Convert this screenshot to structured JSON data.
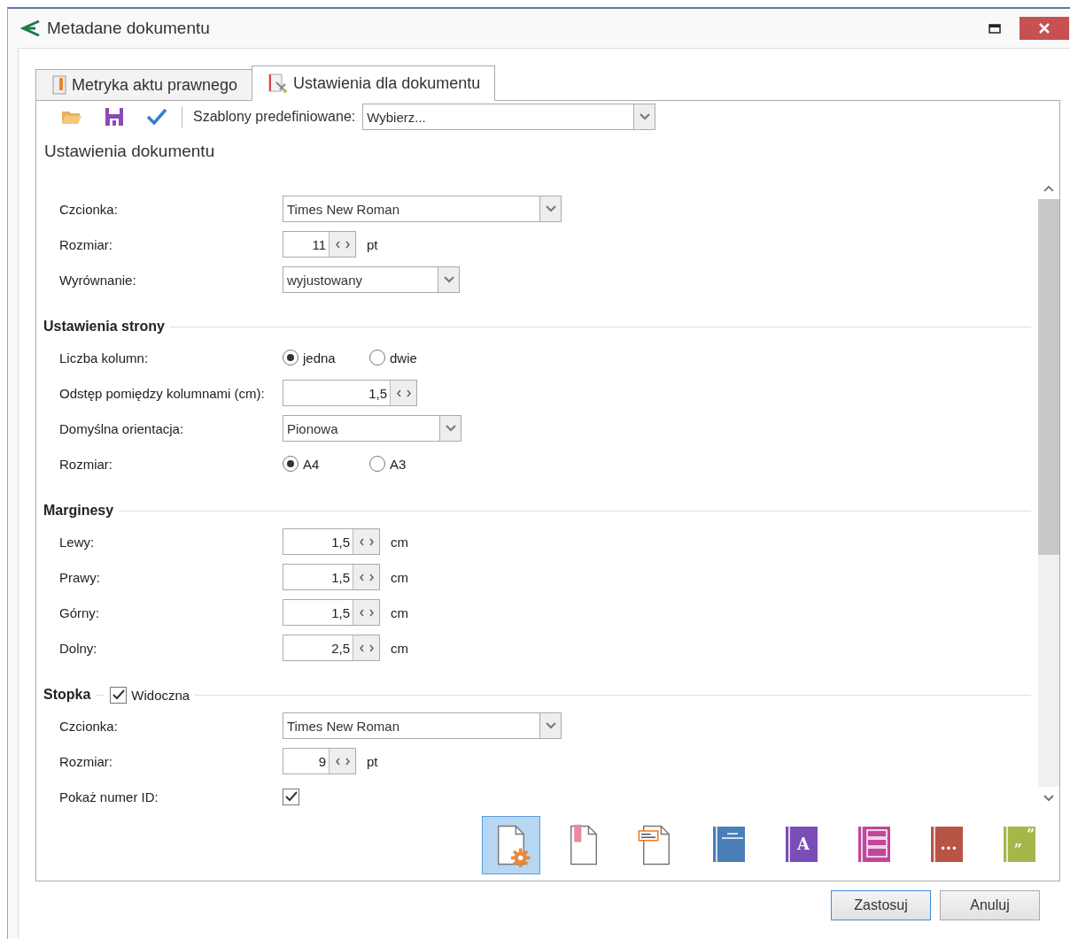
{
  "window": {
    "title": "Metadane dokumentu"
  },
  "tabs": [
    {
      "label": "Metryka aktu prawnego",
      "selected": false,
      "kind": "metric"
    },
    {
      "label": "Ustawienia dla dokumentu",
      "selected": true,
      "kind": "settings"
    }
  ],
  "toolbar": {
    "tools": [
      {
        "kind": "open"
      },
      {
        "kind": "save"
      },
      {
        "kind": "apply"
      }
    ],
    "template_label": "Szablony predefiniowane:",
    "template_value": "Wybierz..."
  },
  "heading": "Ustawienia dokumentu",
  "sections": [
    {
      "rows": [
        {
          "kind": "select",
          "label": "Czcionka:",
          "value": "Times New Roman"
        },
        {
          "kind": "spin",
          "label": "Rozmiar:",
          "value": "11",
          "unit": "pt"
        },
        {
          "kind": "select",
          "label": "Wyrównanie:",
          "value": "wyjustowany"
        }
      ]
    },
    {
      "title": "Ustawienia strony",
      "rows": [
        {
          "kind": "radio",
          "label": "Liczba kolumn:",
          "options": [
            {
              "label": "jedna",
              "selected": true
            },
            {
              "label": "dwie",
              "selected": false
            }
          ]
        },
        {
          "kind": "spin",
          "label": "Odstęp pomiędzy kolumnami (cm):",
          "value": "1,5"
        },
        {
          "kind": "select",
          "label": "Domyślna orientacja:",
          "value": "Pionowa"
        },
        {
          "kind": "radio",
          "label": "Rozmiar:",
          "options": [
            {
              "label": "A4",
              "selected": true
            },
            {
              "label": "A3",
              "selected": false
            }
          ]
        }
      ]
    },
    {
      "title": "Marginesy",
      "rows": [
        {
          "kind": "spin",
          "label": "Lewy:",
          "value": "1,5",
          "unit": "cm"
        },
        {
          "kind": "spin",
          "label": "Prawy:",
          "value": "1,5",
          "unit": "cm"
        },
        {
          "kind": "spin",
          "label": "Górny:",
          "value": "1,5",
          "unit": "cm"
        },
        {
          "kind": "spin",
          "label": "Dolny:",
          "value": "2,5",
          "unit": "cm"
        }
      ]
    },
    {
      "title": "Stopka",
      "toggle": {
        "label": "Widoczna",
        "checked": true
      },
      "rows": [
        {
          "kind": "select",
          "label": "Czcionka:",
          "value": "Times New Roman"
        },
        {
          "kind": "spin",
          "label": "Rozmiar:",
          "value": "9",
          "unit": "pt"
        },
        {
          "kind": "checkbox",
          "label": "Pokaż numer ID:",
          "checked": true
        }
      ]
    }
  ],
  "icon_strip": [
    {
      "kind": "page-gear",
      "selected": true
    },
    {
      "kind": "page-bookmark",
      "selected": false
    },
    {
      "kind": "page-label",
      "selected": false
    },
    {
      "kind": "book-lines",
      "color": "#4a7fb8",
      "selected": false
    },
    {
      "kind": "book-letter",
      "color": "#7a4db8",
      "mark": "A",
      "selected": false
    },
    {
      "kind": "book-rows",
      "color": "#c0479a",
      "selected": false
    },
    {
      "kind": "book-letter",
      "color": "#b85446",
      "mark": "...",
      "selected": false
    },
    {
      "kind": "book-quotes",
      "color": "#a4b84a",
      "marks": [
        "”",
        "„"
      ],
      "selected": false
    }
  ],
  "buttons": [
    {
      "label": "Zastosuj",
      "focused": true
    },
    {
      "label": "Anuluj",
      "focused": false
    }
  ]
}
